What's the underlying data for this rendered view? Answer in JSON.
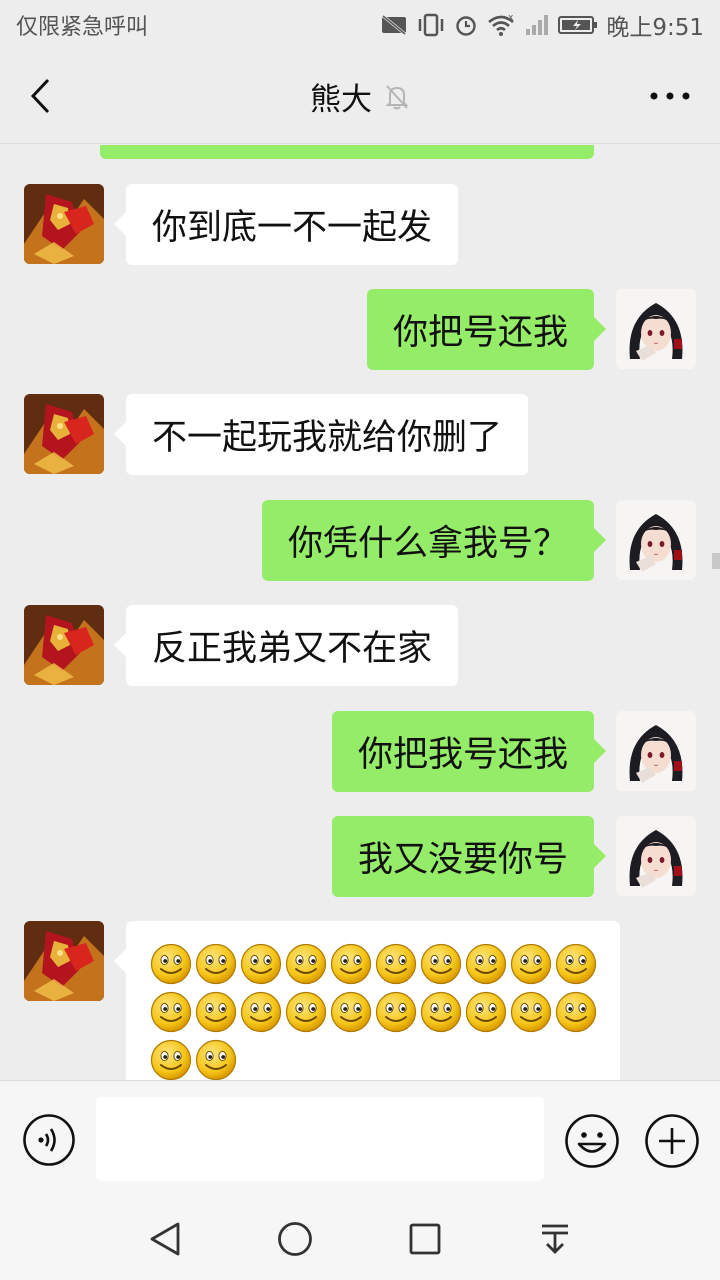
{
  "status_bar": {
    "carrier_text": "仅限紧急呼叫",
    "time": "晚上9:51"
  },
  "header": {
    "title": "熊大",
    "icons": [
      "back-arrow-icon",
      "mute-bell-icon",
      "more-dots-icon"
    ]
  },
  "messages": [
    {
      "side": "in",
      "text": "你到底一不一起发"
    },
    {
      "side": "out",
      "text": "你把号还我"
    },
    {
      "side": "in",
      "text": "不一起玩我就给你删了"
    },
    {
      "side": "out",
      "text": "你凭什么拿我号？"
    },
    {
      "side": "in",
      "text": "反正我弟又不在家"
    },
    {
      "side": "out",
      "text": "你把我号还我"
    },
    {
      "side": "out",
      "text": "我又没要你号"
    }
  ],
  "emoji_message": {
    "side": "in",
    "emoji": "smile-emoji",
    "count": 22
  },
  "input_bar": {
    "value": "",
    "icons": [
      "voice-icon",
      "emoji-icon",
      "plus-icon"
    ]
  },
  "nav_bar": {
    "icons": [
      "back-triangle-icon",
      "home-circle-icon",
      "recents-square-icon",
      "notification-down-icon"
    ]
  },
  "colors": {
    "background": "#ededed",
    "outgoing_bubble": "#95ec69",
    "incoming_bubble": "#ffffff"
  }
}
